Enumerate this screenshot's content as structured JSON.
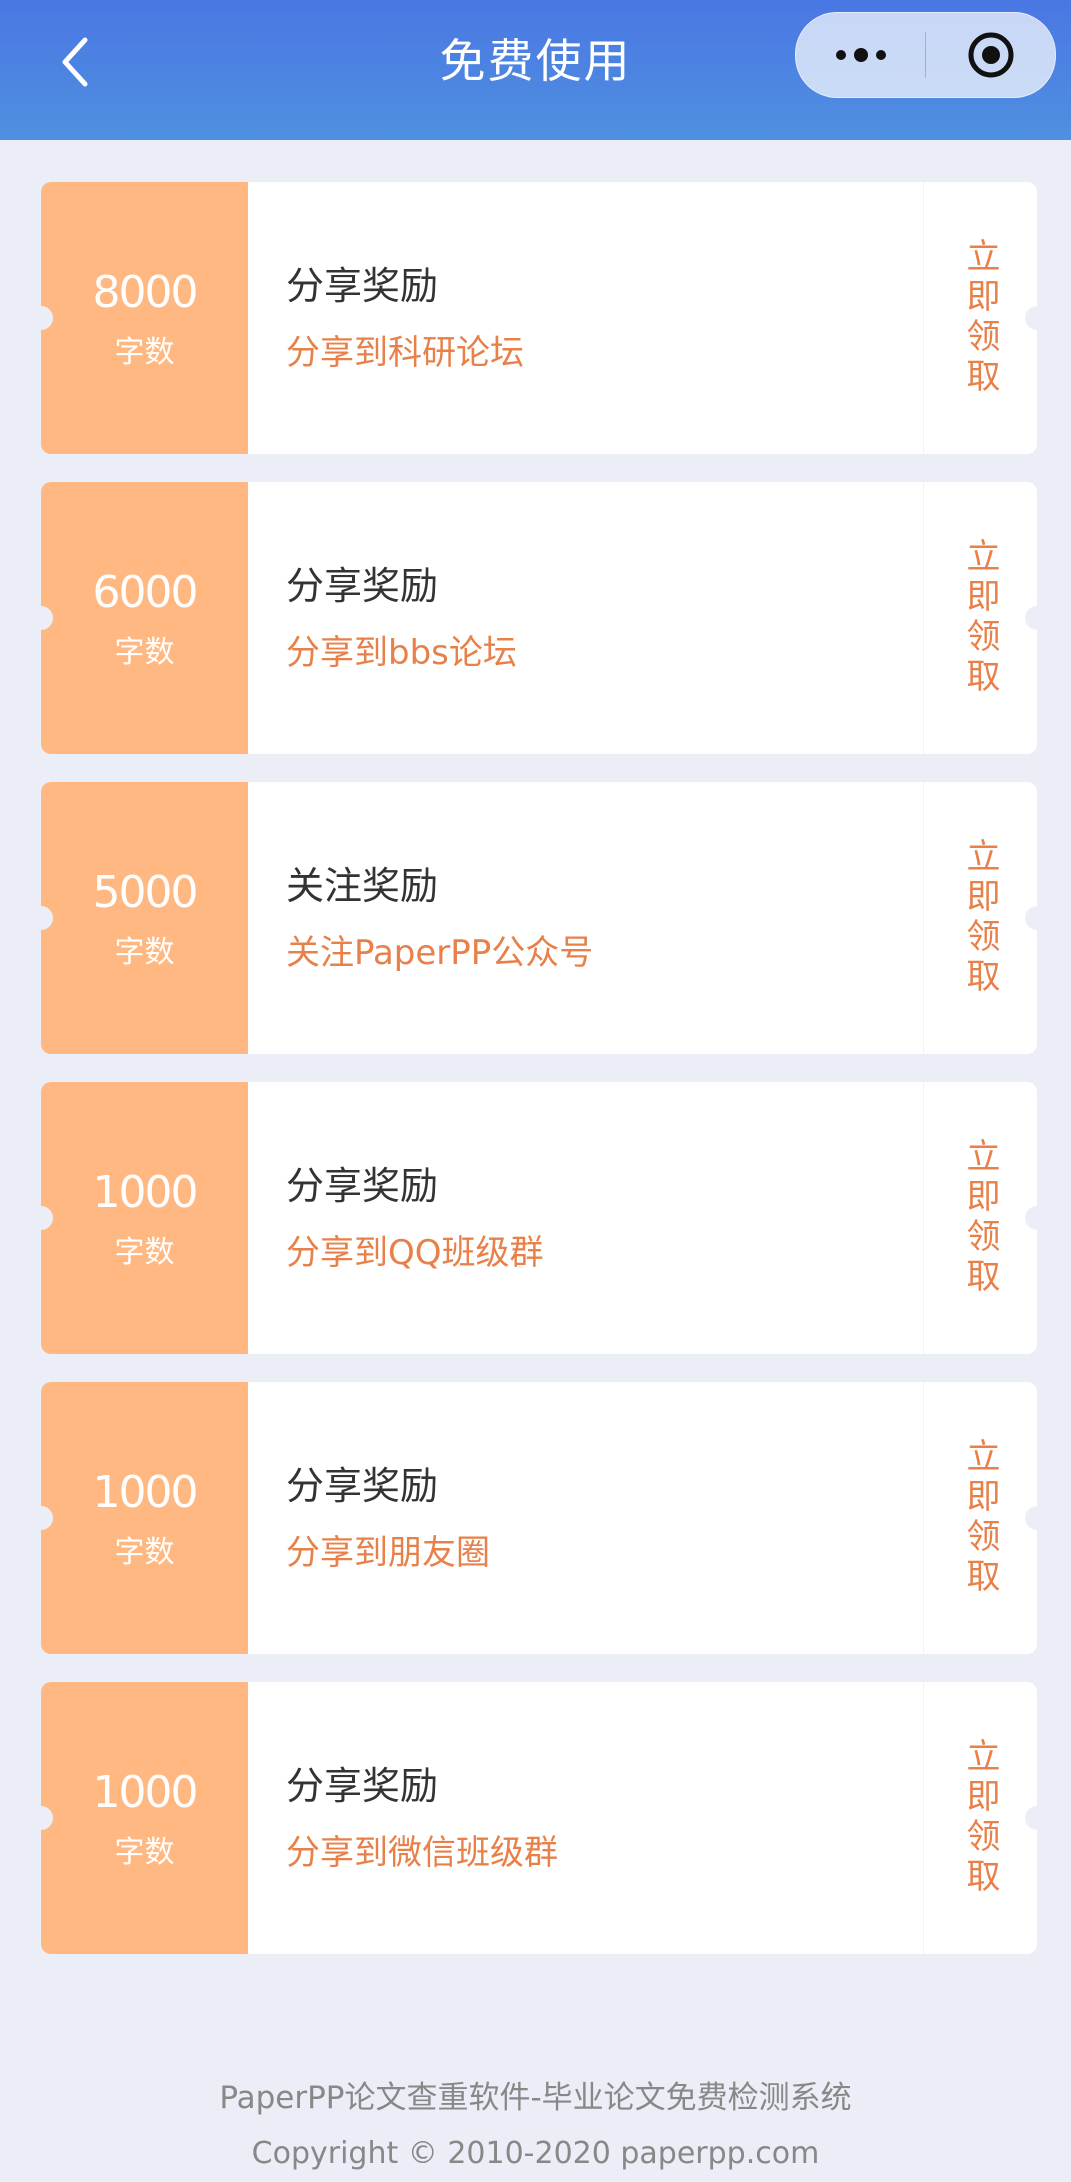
{
  "header": {
    "title": "免费使用",
    "bg_color_top": "#4a77e3",
    "bg_color_bottom": "#4f90e0",
    "back_icon": "chevron-left-icon",
    "more_icon": "more-dots-icon",
    "close_icon": "target-circle-icon"
  },
  "colors": {
    "quota_bg": "#ffb882",
    "accent": "#e8804a",
    "page_bg": "#ebeef6"
  },
  "rewards": [
    {
      "amount": "8000",
      "unit": "字数",
      "title": "分享奖励",
      "desc": "分享到科研论坛",
      "action": "立即领取"
    },
    {
      "amount": "6000",
      "unit": "字数",
      "title": "分享奖励",
      "desc": "分享到bbs论坛",
      "action": "立即领取"
    },
    {
      "amount": "5000",
      "unit": "字数",
      "title": "关注奖励",
      "desc": "关注PaperPP公众号",
      "action": "立即领取"
    },
    {
      "amount": "1000",
      "unit": "字数",
      "title": "分享奖励",
      "desc": "分享到QQ班级群",
      "action": "立即领取"
    },
    {
      "amount": "1000",
      "unit": "字数",
      "title": "分享奖励",
      "desc": "分享到朋友圈",
      "action": "立即领取"
    },
    {
      "amount": "1000",
      "unit": "字数",
      "title": "分享奖励",
      "desc": "分享到微信班级群",
      "action": "立即领取"
    }
  ],
  "footer": {
    "tagline": "PaperPP论文查重软件-毕业论文免费检测系统",
    "copyright": "Copyright © 2010-2020 paperpp.com"
  }
}
